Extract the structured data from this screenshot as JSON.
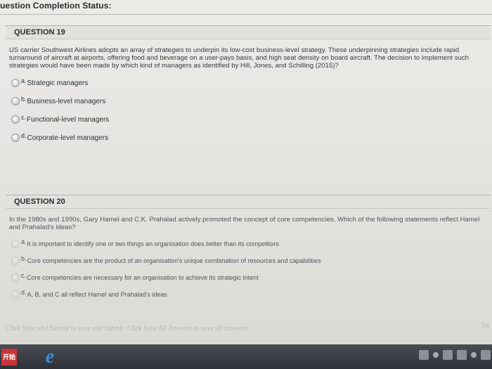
{
  "status_header": "uestion Completion Status:",
  "questions": [
    {
      "title": "QUESTION 19",
      "text": "US carrier Southwest Airlines adopts an array of strategies to underpin its low-cost business-level strategy. These underpinning strategies include rapid turnaround of aircraft at airports, offering food and beverage on a user-pays basis, and high seat density on board aircraft. The decision to implement such strategies would have been made by which kind of managers as identified by Hill, Jones, and Schilling (2015)?",
      "options": [
        {
          "letter": "a.",
          "label": "Strategic managers"
        },
        {
          "letter": "b.",
          "label": "Business-level managers"
        },
        {
          "letter": "c.",
          "label": "Functional-level managers"
        },
        {
          "letter": "d.",
          "label": "Corporate-level managers"
        }
      ]
    },
    {
      "title": "QUESTION 20",
      "text": "In the 1980s and 1990s, Gary Hamel and C.K. Prahalad actively promoted the concept of core competencies. Which of the following statements reflect Hamel and Prahalad's ideas?",
      "options": [
        {
          "letter": "a.",
          "label": "It is important to identify one or two things an organisation does better than its competitors"
        },
        {
          "letter": "b.",
          "label": "Core competencies are the product of an organisation's unique combination of resources and capabilities"
        },
        {
          "letter": "c.",
          "label": "Core competencies are necessary for an organisation to achieve its strategic intent"
        },
        {
          "letter": "d.",
          "label": "A, B, and C all reflect Hamel and Prahalad's ideas"
        }
      ]
    }
  ],
  "footer": {
    "instruction": "Click Save and Submit to save and submit. Click Save All Answers to save all answers.",
    "save_button": "Sa"
  },
  "taskbar": {
    "start_label": "开始"
  }
}
